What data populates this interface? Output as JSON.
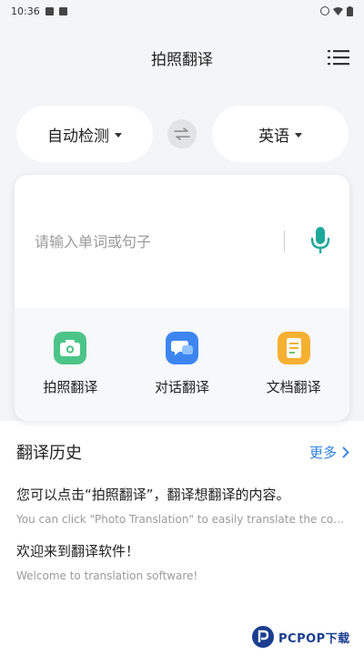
{
  "status_bar": {
    "time": "10:36"
  },
  "app_bar": {
    "title": "拍照翻译",
    "menu_icon": "list-menu-icon"
  },
  "language": {
    "source": "自动检测",
    "target": "英语",
    "swap_icon": "swap-arrows-icon"
  },
  "input": {
    "placeholder": "请输入单词或句子",
    "value": ""
  },
  "tools": [
    {
      "label": "拍照翻译",
      "icon": "camera-icon",
      "color": "#4cc488"
    },
    {
      "label": "对话翻译",
      "icon": "chat-icon",
      "color": "#3d86f2"
    },
    {
      "label": "文档翻译",
      "icon": "document-icon",
      "color": "#f6b032"
    }
  ],
  "history": {
    "title": "翻译历史",
    "more_label": "更多",
    "items": [
      {
        "zh": "您可以点击“拍照翻译”，翻译想翻译的内容。",
        "en": "You can click \"Photo Translation\" to easily translate the content you want to translate."
      },
      {
        "zh": "欢迎来到翻译软件！",
        "en": "Welcome to translation software!"
      }
    ]
  },
  "watermark": {
    "text": "PCPOP下载"
  },
  "colors": {
    "accent": "#2f7fe6",
    "mic": "#1fa89a",
    "background": "#f4f5f7"
  }
}
